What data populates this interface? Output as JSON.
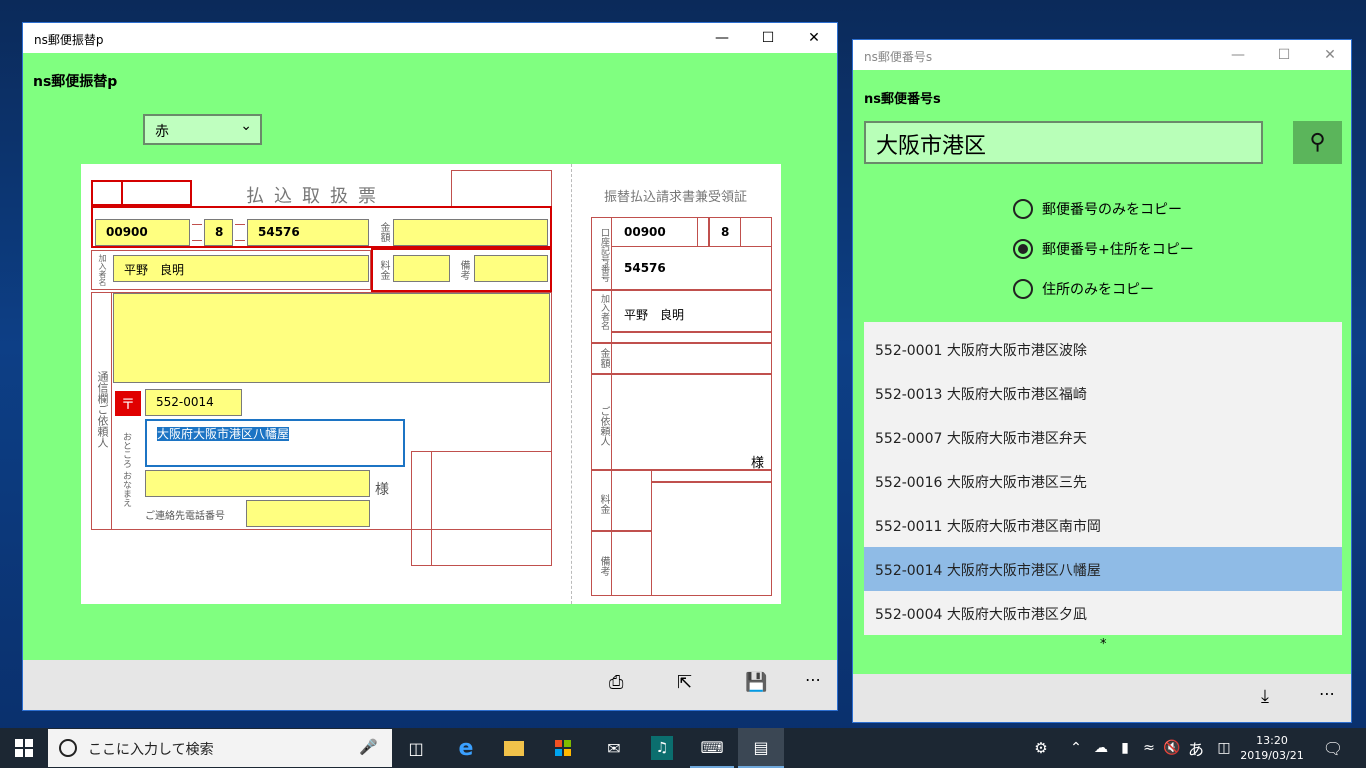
{
  "left_window": {
    "title": "ns郵便振替p",
    "header": "ns郵便振替p",
    "color_select": "赤",
    "form": {
      "title": "払込取扱票",
      "account_no1": "00900",
      "account_check": "8",
      "account_no2": "54576",
      "label_kingaku": "金額",
      "label_subscriber": "加入者名",
      "subscriber": "平野　良明",
      "label_ryokin": "料金",
      "label_biko": "備考",
      "label_communication": "通信欄ご依頼人",
      "postal_mark": "〒",
      "postal_code": "552-0014",
      "label_address": "おところ おなまえ",
      "address": "大阪府大阪市港区八幡屋",
      "sama": "様",
      "label_phone": "ご連絡先電話番号",
      "receipt_title": "振替払込請求書兼受領証",
      "receipt_label_account": "口座記号番号",
      "receipt_account_no1": "00900",
      "receipt_account_check": "8",
      "receipt_account_no2": "54576",
      "receipt_label_subscriber": "加入者名",
      "receipt_subscriber": "平野　良明",
      "receipt_label_kingaku": "金額",
      "receipt_label_requester": "ご依頼人",
      "receipt_sama": "様",
      "receipt_label_ryokin": "料金",
      "receipt_label_biko": "備考"
    }
  },
  "right_window": {
    "title": "ns郵便番号s",
    "header": "ns郵便番号s",
    "search_value": "大阪市港区",
    "radio_options": [
      "郵便番号のみをコピー",
      "郵便番号+住所をコピー",
      "住所のみをコピー"
    ],
    "radio_selected": 1,
    "results": [
      "552-0001 大阪府大阪市港区波除",
      "552-0013 大阪府大阪市港区福崎",
      "552-0007 大阪府大阪市港区弁天",
      "552-0016 大阪府大阪市港区三先",
      "552-0011 大阪府大阪市港区南市岡",
      "552-0014 大阪府大阪市港区八幡屋",
      "552-0004 大阪府大阪市港区夕凪"
    ],
    "selected_result": 5,
    "list_footer": "*"
  },
  "taskbar": {
    "search_placeholder": "ここに入力して検索",
    "time": "13:20",
    "date": "2019/03/21",
    "ime": "あ"
  },
  "colors": {
    "app_bg": "#80ff80",
    "field_yellow": "#ffff80",
    "red_line": "#c0504d",
    "highlight_red": "#d40000",
    "selected_row": "#8fbbe6"
  }
}
